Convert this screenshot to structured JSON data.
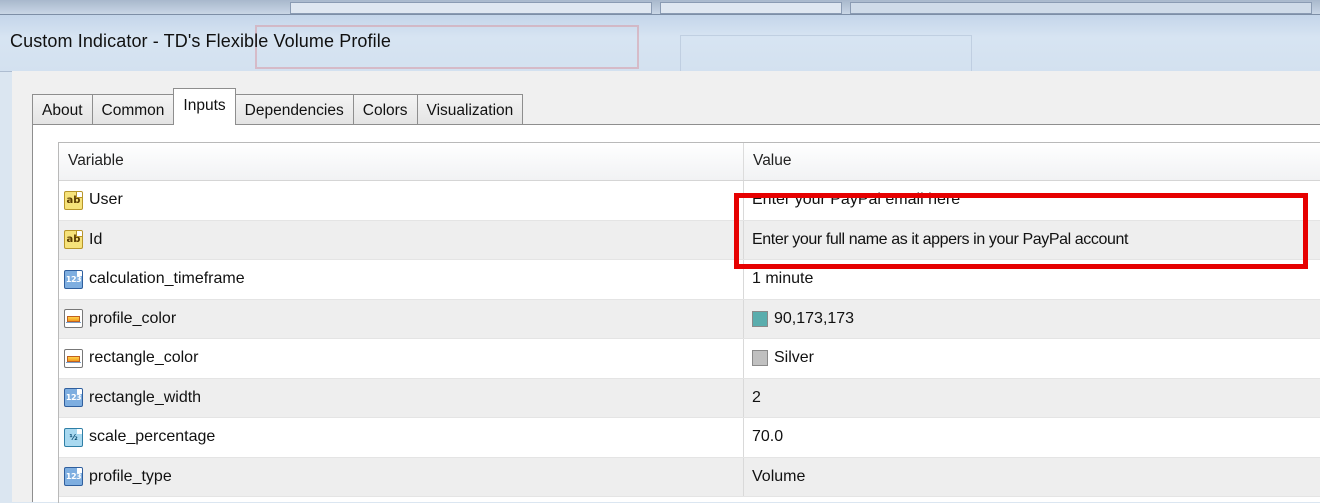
{
  "window": {
    "title": "Custom Indicator - TD's Flexible Volume Profile"
  },
  "tabs": [
    {
      "label": "About",
      "active": false
    },
    {
      "label": "Common",
      "active": false
    },
    {
      "label": "Inputs",
      "active": true
    },
    {
      "label": "Dependencies",
      "active": false
    },
    {
      "label": "Colors",
      "active": false
    },
    {
      "label": "Visualization",
      "active": false
    }
  ],
  "grid": {
    "headers": {
      "variable": "Variable",
      "value": "Value"
    },
    "rows": [
      {
        "icon": "string-type-icon",
        "icon_text": "ab",
        "variable": "User",
        "value": "Enter your PayPal email here",
        "highlighted": true
      },
      {
        "icon": "string-type-icon",
        "icon_text": "ab",
        "variable": "Id",
        "value": "Enter your full name as it appers in your PayPal account",
        "highlighted": true
      },
      {
        "icon": "integer-type-icon",
        "icon_text": "123",
        "variable": "calculation_timeframe",
        "value": "1 minute"
      },
      {
        "icon": "color-type-icon",
        "variable": "profile_color",
        "value": "90,173,173",
        "swatch": "#5aadad"
      },
      {
        "icon": "color-type-icon",
        "variable": "rectangle_color",
        "value": "Silver",
        "swatch": "#c0c0c0"
      },
      {
        "icon": "integer-type-icon",
        "icon_text": "123",
        "variable": "rectangle_width",
        "value": "2"
      },
      {
        "icon": "double-type-icon",
        "icon_text": "½",
        "variable": "scale_percentage",
        "value": "70.0"
      },
      {
        "icon": "integer-type-icon",
        "icon_text": "123",
        "variable": "profile_type",
        "value": "Volume"
      }
    ]
  },
  "colors": {
    "highlight": "#e60000",
    "profile_color": "#5aadad",
    "silver": "#c0c0c0"
  }
}
